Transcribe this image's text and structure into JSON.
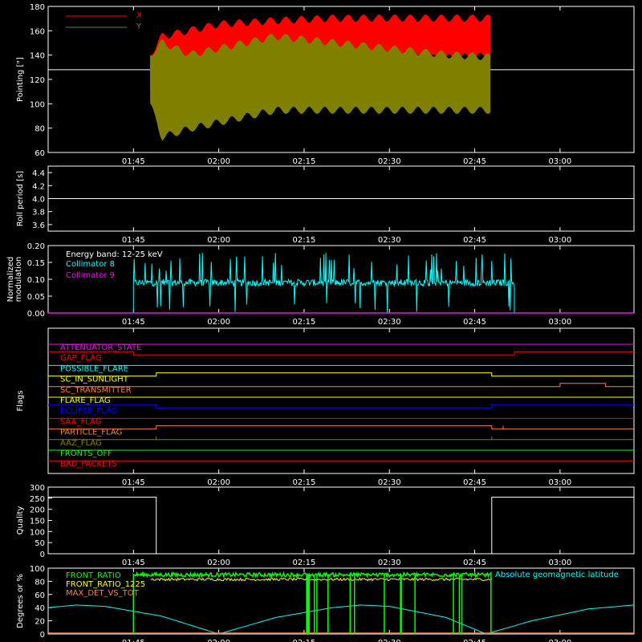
{
  "colors": {
    "background": "#000000",
    "axes": "#ffffff",
    "x": "#ff0000",
    "y": "#808000",
    "cyan": "#00ffff",
    "magenta": "#ff00ff",
    "green": "#00ff00",
    "yellow": "#ffff00",
    "orange": "#ff8040",
    "blue": "#0000ff",
    "red": "#ff0000",
    "olive": "#808000"
  },
  "time_axis": {
    "range": [
      "01:30",
      "03:13"
    ],
    "ticks": [
      "01:45",
      "02:00",
      "02:15",
      "02:30",
      "02:45",
      "03:00"
    ]
  },
  "chart_data": [
    {
      "id": "pointing",
      "type": "line",
      "ylabel": "Pointing [\"]",
      "ylim": [
        60,
        180
      ],
      "yticks": [
        "60",
        "80",
        "100",
        "120",
        "140",
        "160",
        "180"
      ],
      "reference_line": 128,
      "legend": [
        "X",
        "Y"
      ],
      "legend_position": "top-left",
      "series": [
        {
          "name": "X",
          "color": "red",
          "envelope": [
            {
              "t": "01:48",
              "low": 110,
              "high": 140
            },
            {
              "t": "01:50",
              "low": 75,
              "high": 155
            },
            {
              "t": "01:55",
              "low": 95,
              "high": 160
            },
            {
              "t": "02:00",
              "low": 110,
              "high": 165
            },
            {
              "t": "02:10",
              "low": 128,
              "high": 168
            },
            {
              "t": "02:20",
              "low": 135,
              "high": 170
            },
            {
              "t": "02:30",
              "low": 138,
              "high": 170
            },
            {
              "t": "02:40",
              "low": 138,
              "high": 170
            },
            {
              "t": "02:48",
              "low": 140,
              "high": 170
            }
          ]
        },
        {
          "name": "Y",
          "color": "olive",
          "envelope": [
            {
              "t": "01:48",
              "low": 100,
              "high": 140
            },
            {
              "t": "01:50",
              "low": 73,
              "high": 150
            },
            {
              "t": "01:55",
              "low": 80,
              "high": 140
            },
            {
              "t": "02:00",
              "low": 85,
              "high": 145
            },
            {
              "t": "02:10",
              "low": 95,
              "high": 155
            },
            {
              "t": "02:20",
              "low": 95,
              "high": 150
            },
            {
              "t": "02:30",
              "low": 95,
              "high": 145
            },
            {
              "t": "02:40",
              "low": 95,
              "high": 140
            },
            {
              "t": "02:48",
              "low": 95,
              "high": 138
            }
          ]
        }
      ]
    },
    {
      "id": "roll",
      "type": "line",
      "ylabel": "Roll period [s]",
      "ylim": [
        3.5,
        4.5
      ],
      "yticks": [
        "3.6",
        "3.8",
        "4.0",
        "4.2",
        "4.4"
      ],
      "series": [
        {
          "name": "",
          "color": "white",
          "value": 4.0
        }
      ]
    },
    {
      "id": "modulation",
      "type": "line",
      "ylabel": "Normalized modulation",
      "ylim": [
        0,
        0.2
      ],
      "yticks": [
        "0.00",
        "0.05",
        "0.10",
        "0.15",
        "0.20"
      ],
      "legend_title": "Energy band: 12-25 keV",
      "legend": [
        "Collimator 8",
        "Collimator 9"
      ],
      "legend_position": "top-left",
      "series": [
        {
          "name": "Collimator 8",
          "color": "cyan",
          "start": "01:45",
          "end": "02:52",
          "baseline": 0.09
        },
        {
          "name": "Collimator 9",
          "color": "magenta",
          "value": 0.0
        }
      ]
    },
    {
      "id": "flags",
      "type": "line",
      "ylabel": "Flags",
      "series": [
        {
          "name": "ATTENUATOR_STATE",
          "color": "magenta",
          "steps": [
            {
              "t": "01:30",
              "v": 0
            }
          ]
        },
        {
          "name": "GAP_FLAG",
          "color": "red",
          "steps": [
            {
              "t": "01:30",
              "v": 1
            },
            {
              "t": "01:45",
              "v": 0
            },
            {
              "t": "02:52",
              "v": 1
            }
          ]
        },
        {
          "name": "POSSIBLE_FLARE",
          "color": "cyan",
          "steps": [
            {
              "t": "01:30",
              "v": 0
            }
          ]
        },
        {
          "name": "SC_IN_SUNLIGHT",
          "color": "yellow",
          "steps": [
            {
              "t": "01:30",
              "v": 0
            },
            {
              "t": "01:49",
              "v": 1
            },
            {
              "t": "02:48",
              "v": 0
            }
          ]
        },
        {
          "name": "SC_TRANSMITTER",
          "color": "orange",
          "steps": [
            {
              "t": "01:30",
              "v": 0
            },
            {
              "t": "03:00",
              "v": 1
            },
            {
              "t": "03:08",
              "v": 0
            }
          ]
        },
        {
          "name": "FLARE_FLAG",
          "color": "yellow",
          "steps": [
            {
              "t": "01:30",
              "v": 0
            }
          ]
        },
        {
          "name": "ECLIPSE_FLAG",
          "color": "blue",
          "steps": [
            {
              "t": "01:30",
              "v": 1
            },
            {
              "t": "01:49",
              "v": 0
            },
            {
              "t": "02:48",
              "v": 1
            }
          ]
        },
        {
          "name": "SAA_FLAG",
          "color": "red",
          "steps": [
            {
              "t": "01:30",
              "v": 0
            }
          ]
        },
        {
          "name": "PARTICLE_FLAG",
          "color": "orange",
          "steps": [
            {
              "t": "01:30",
              "v": 0
            },
            {
              "t": "01:49",
              "v": 1
            },
            {
              "t": "02:48",
              "v": 0
            },
            {
              "t": "02:50",
              "v": 1
            },
            {
              "t": "02:50",
              "v": 0
            }
          ]
        },
        {
          "name": "AAZ_FLAG",
          "color": "olive",
          "steps": [
            {
              "t": "01:30",
              "v": 0
            },
            {
              "t": "01:49",
              "v": 1
            },
            {
              "t": "01:49",
              "v": 0
            },
            {
              "t": "02:48",
              "v": 1
            },
            {
              "t": "02:48",
              "v": 0
            }
          ]
        },
        {
          "name": "FRONTS_OFF",
          "color": "green",
          "steps": [
            {
              "t": "01:30",
              "v": 0
            }
          ]
        },
        {
          "name": "BAD_PACKETS",
          "color": "red",
          "steps": [
            {
              "t": "01:30",
              "v": 0
            }
          ]
        }
      ]
    },
    {
      "id": "quality",
      "type": "line",
      "ylabel": "Quality",
      "ylim": [
        0,
        300
      ],
      "yticks": [
        "0",
        "50",
        "100",
        "150",
        "200",
        "250",
        "300"
      ],
      "series": [
        {
          "name": "",
          "color": "white",
          "steps": [
            {
              "t": "01:30",
              "v": 255
            },
            {
              "t": "01:49",
              "v": 0
            },
            {
              "t": "02:48",
              "v": 255
            }
          ]
        }
      ]
    },
    {
      "id": "ratios",
      "type": "line",
      "ylabel": "Degrees or %",
      "ylim": [
        0,
        100
      ],
      "yticks": [
        "0",
        "20",
        "40",
        "60",
        "80",
        "100"
      ],
      "legend": [
        "FRONT_RATIO",
        "FRONT_RATIO_1225",
        "MAX_DET_VS_TOT",
        "Absolute geomagnetic latitude"
      ],
      "series": [
        {
          "name": "FRONT_RATIO",
          "color": "green",
          "start": "01:45",
          "end": "02:48",
          "baseline": 90
        },
        {
          "name": "FRONT_RATIO_1225",
          "color": "yellow",
          "start": "01:48",
          "end": "02:48",
          "baseline": 83
        },
        {
          "name": "MAX_DET_VS_TOT",
          "color": "orange",
          "value": 0
        },
        {
          "name": "Absolute geomagnetic latitude",
          "color": "cyan",
          "points": [
            {
              "t": "01:30",
              "v": 40
            },
            {
              "t": "01:35",
              "v": 44
            },
            {
              "t": "01:40",
              "v": 42
            },
            {
              "t": "01:50",
              "v": 27
            },
            {
              "t": "02:00",
              "v": 0
            },
            {
              "t": "02:10",
              "v": 25
            },
            {
              "t": "02:20",
              "v": 40
            },
            {
              "t": "02:25",
              "v": 44
            },
            {
              "t": "02:30",
              "v": 42
            },
            {
              "t": "02:40",
              "v": 25
            },
            {
              "t": "02:47",
              "v": 0
            },
            {
              "t": "02:55",
              "v": 20
            },
            {
              "t": "03:05",
              "v": 38
            },
            {
              "t": "03:13",
              "v": 44
            }
          ]
        }
      ]
    }
  ]
}
